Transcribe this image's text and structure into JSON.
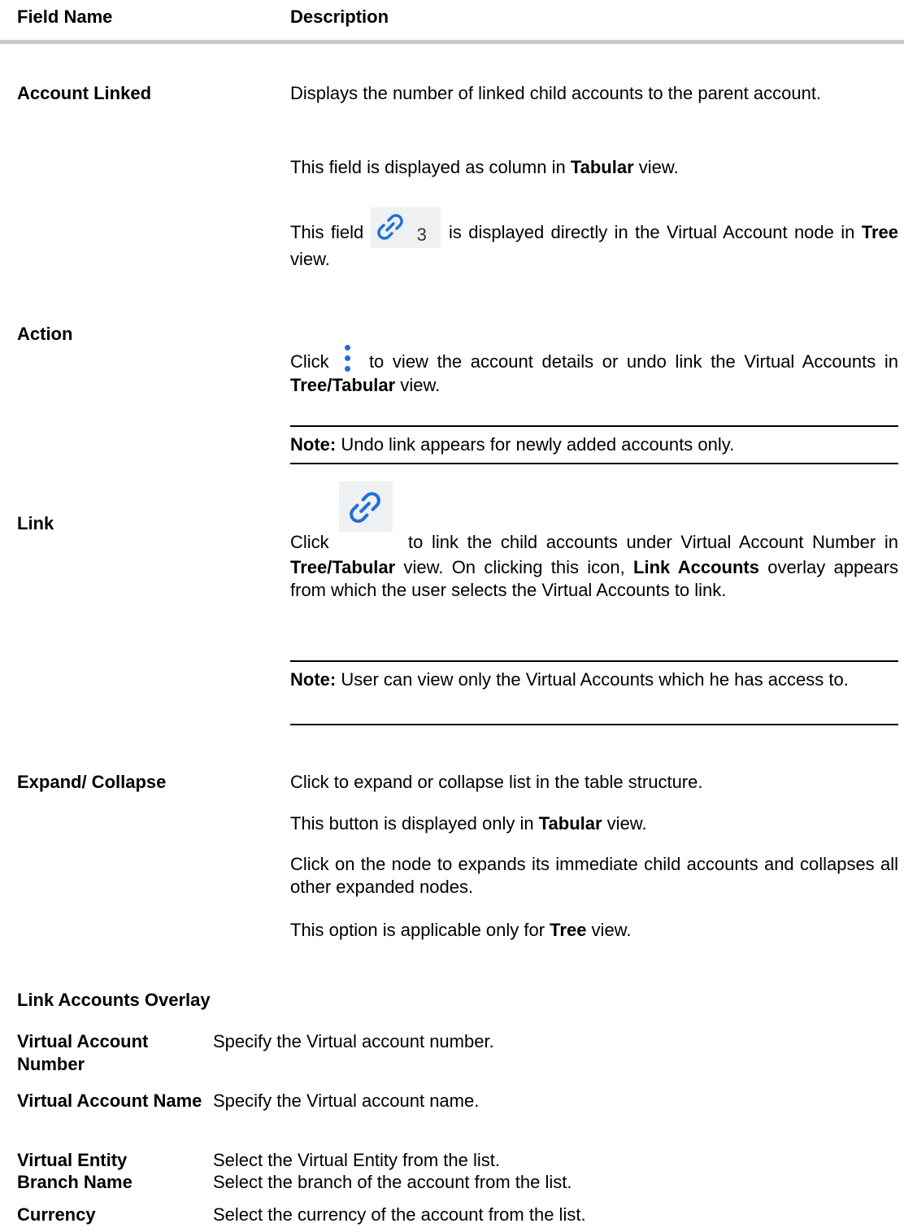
{
  "header": {
    "field_name": "Field Name",
    "description": "Description"
  },
  "rows": {
    "account_linked": {
      "name": "Account Linked",
      "p1": "Displays the number of linked child accounts to the parent account.",
      "p2_pre": "This field is displayed as column in ",
      "p2_bold": "Tabular",
      "p2_post": " view.",
      "p3_pre": "This field ",
      "p3_badge": "3",
      "p3_mid": " is displayed directly in the Virtual Account node in ",
      "p3_bold": "Tree",
      "p3_post": " view."
    },
    "action": {
      "name": "Action",
      "p1_pre": "Click ",
      "p1_mid": " to view the account details or undo link the Virtual Accounts in ",
      "p1_bold": "Tree/Tabular",
      "p1_post": " view.",
      "note_label": "Note:",
      "note_text": " Undo link appears for newly added accounts only."
    },
    "link": {
      "name": "Link",
      "p1_pre": "Click ",
      "p1_mid": " to link the child accounts under Virtual Account Number in ",
      "p1_bold1": "Tree/Tabular",
      "p1_mid2": " view. On clicking this icon, ",
      "p1_bold2": "Link Accounts",
      "p1_post": " overlay appears from which the user selects the Virtual Accounts to link.",
      "note_label": "Note:",
      "note_text": " User can view only the Virtual Accounts which he has access to."
    },
    "expand": {
      "name": "Expand/ Collapse",
      "p1": "Click to expand or collapse list in the table structure.",
      "p2_pre": "This button is displayed only in ",
      "p2_bold": "Tabular",
      "p2_post": " view.",
      "p3": "Click on the node to expands its immediate child accounts and collapses all other expanded nodes.",
      "p4_pre": "This option is applicable only for ",
      "p4_bold": "Tree",
      "p4_post": " view."
    }
  },
  "overlay": {
    "title": "Link Accounts Overlay",
    "fields": [
      {
        "name": "Virtual Account Number",
        "desc": "Specify the Virtual account number."
      },
      {
        "name": "Virtual Account Name",
        "desc": "Specify the Virtual account name."
      },
      {
        "name": "Virtual Entity",
        "desc": "Select the Virtual Entity from the list."
      },
      {
        "name": "Branch Name",
        "desc": "Select the branch of the account from the list."
      },
      {
        "name": "Currency",
        "desc": "Select the currency of the account from the list."
      }
    ]
  },
  "colors": {
    "header_rule": "#c8c8c8",
    "icon_blue": "#1f6fd6",
    "icon_bg": "#eef0f2"
  }
}
